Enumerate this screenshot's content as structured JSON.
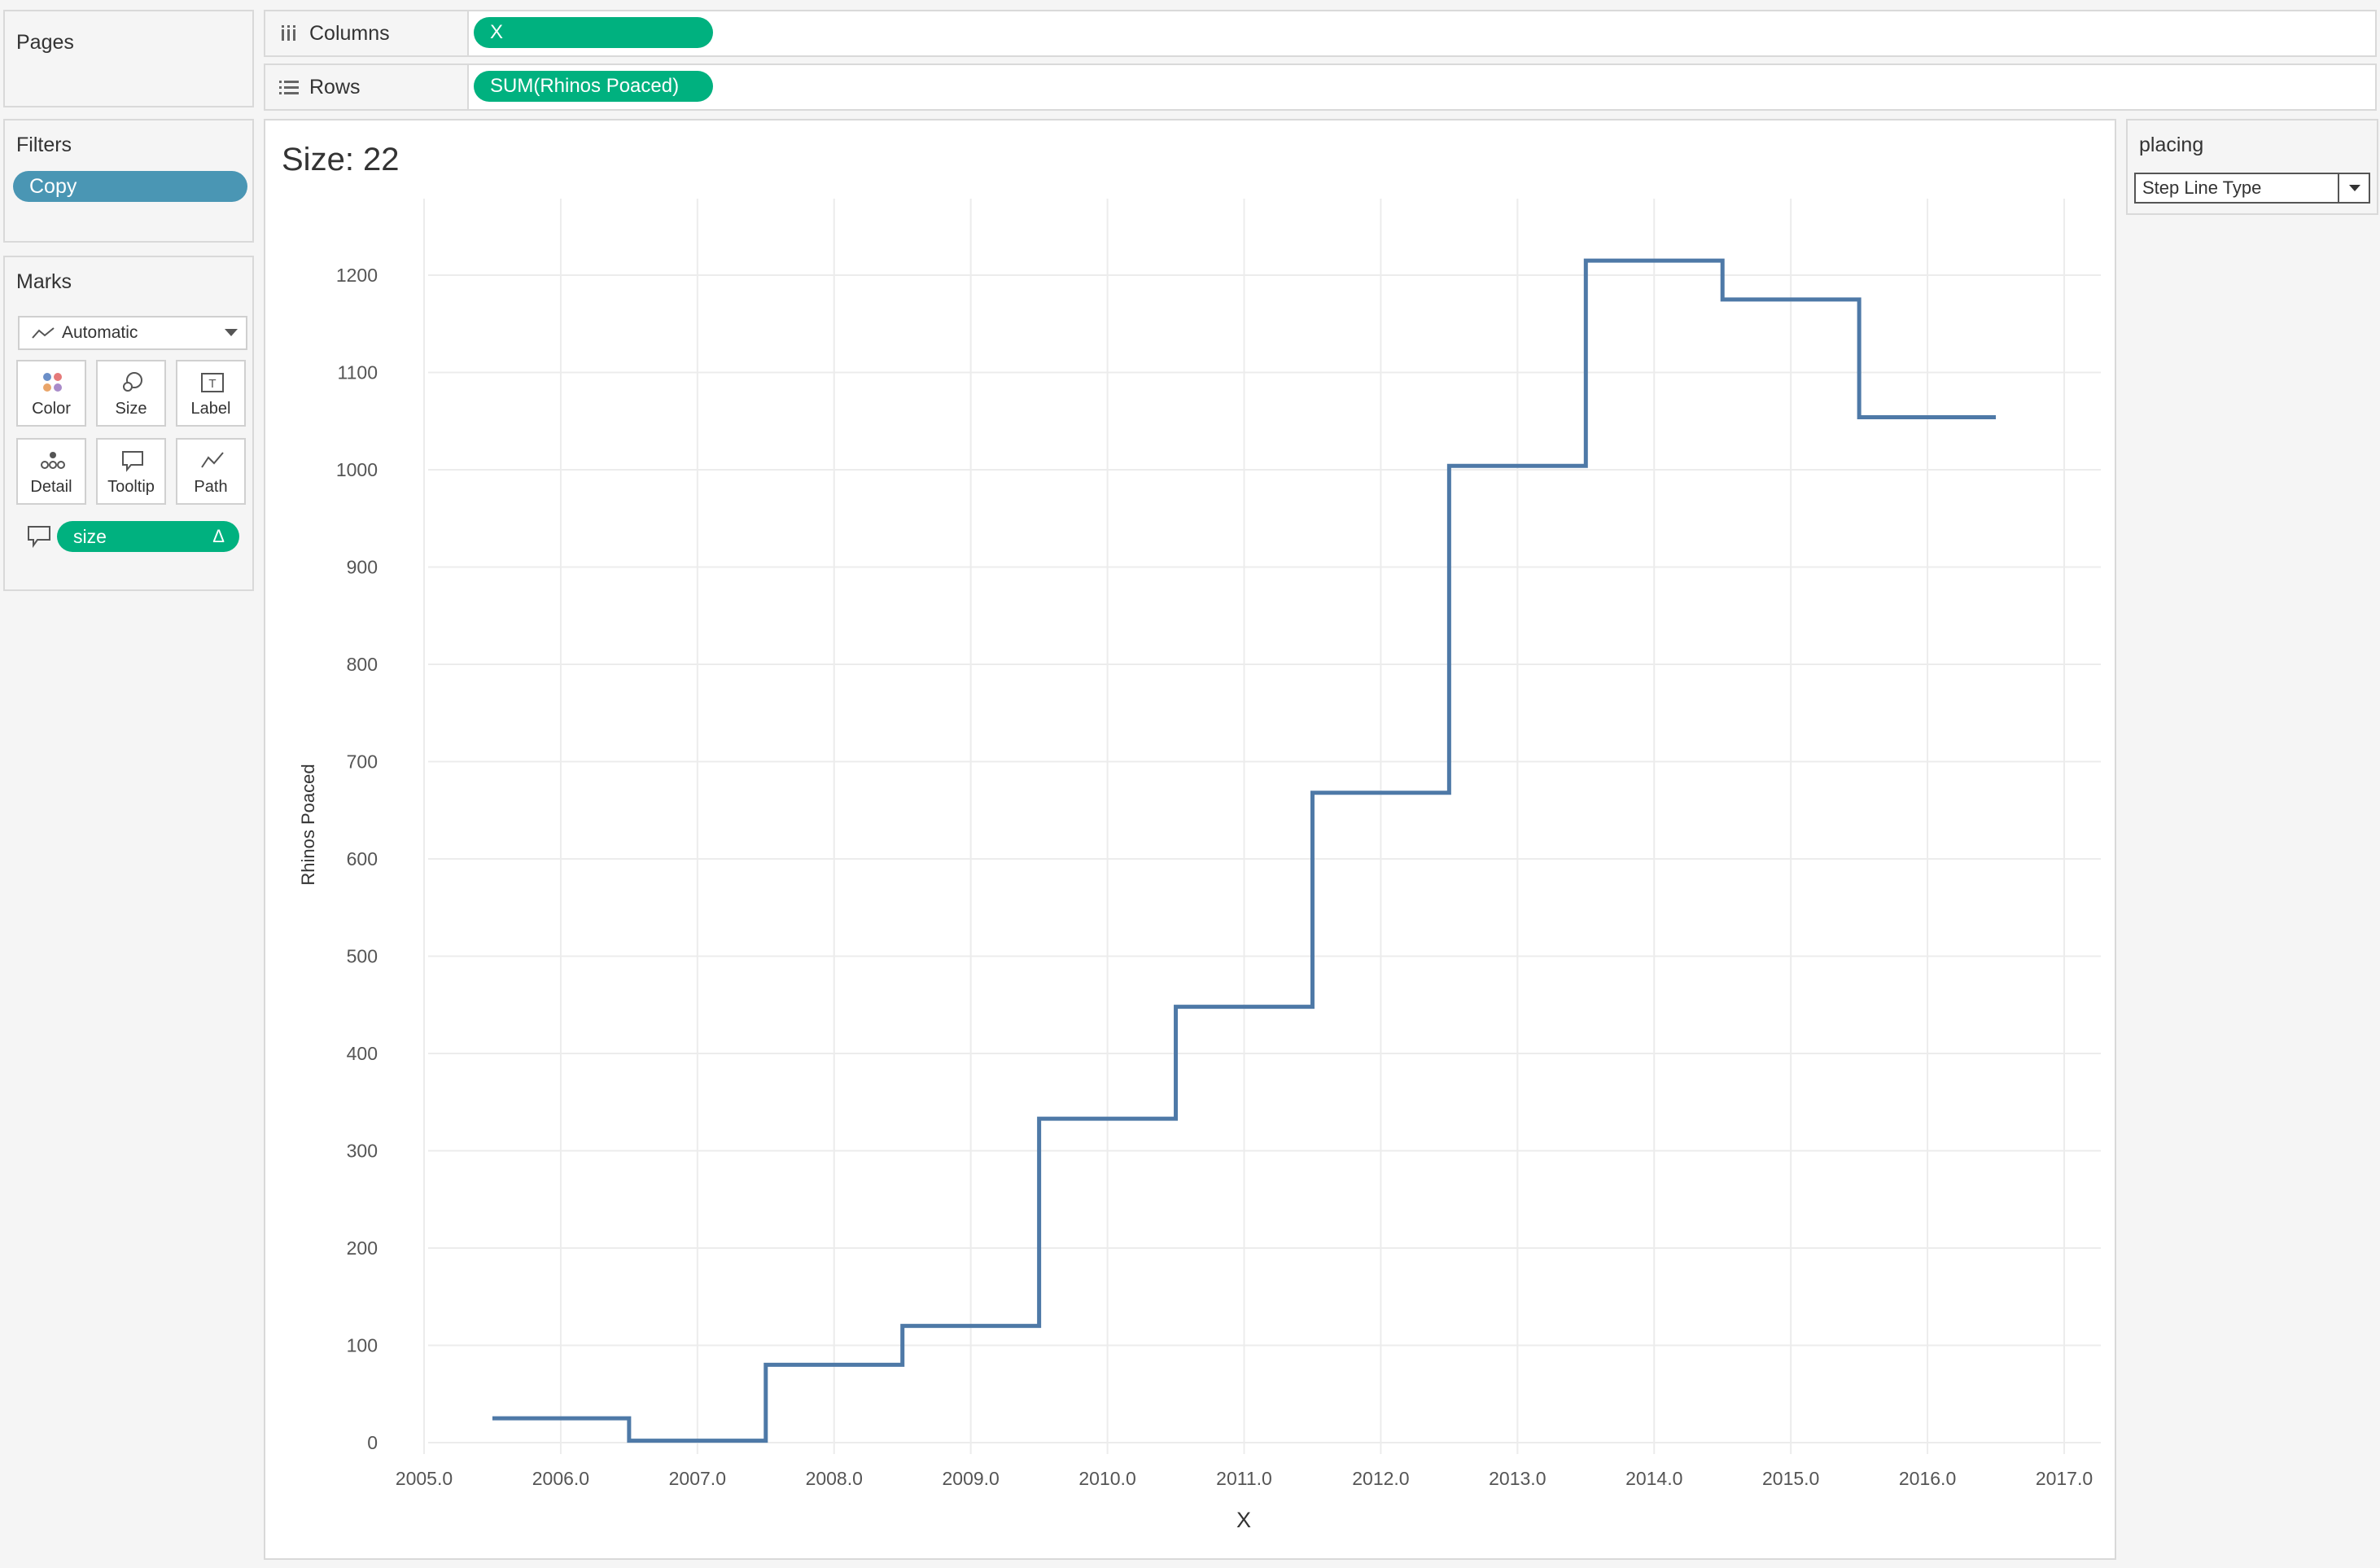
{
  "pages": {
    "title": "Pages"
  },
  "shelves": {
    "columns": {
      "label": "Columns",
      "pill": "X"
    },
    "rows": {
      "label": "Rows",
      "pill": "SUM(Rhinos Poaced)"
    }
  },
  "filters": {
    "title": "Filters",
    "pills": [
      "Copy"
    ]
  },
  "marks": {
    "title": "Marks",
    "mark_type": "Automatic",
    "buttons": {
      "color": "Color",
      "size": "Size",
      "label": "Label",
      "detail": "Detail",
      "tooltip": "Tooltip",
      "path": "Path"
    },
    "field_pill": "size",
    "field_pill_symbol": "Δ"
  },
  "parameter": {
    "title": "placing",
    "value": "Step Line Type"
  },
  "viz": {
    "title": "Size: 22"
  },
  "colors": {
    "line": "#4e79a7",
    "pill_green": "#00b17f",
    "pill_blue": "#4a96b4",
    "grid": "#ececec"
  },
  "chart_data": {
    "type": "line",
    "line_style": "step",
    "title": "",
    "xlabel": "X",
    "ylabel": "Rhinos Poaced",
    "x": [
      2006,
      2007,
      2008,
      2009,
      2010,
      2011,
      2012,
      2013,
      2014,
      2015,
      2016
    ],
    "series": [
      {
        "values": [
          25,
          2,
          80,
          120,
          333,
          448,
          668,
          1004,
          1215,
          1175,
          1054
        ]
      }
    ],
    "xlim": [
      2005,
      2017
    ],
    "ylim": [
      0,
      1200
    ],
    "x_ticks": [
      "2005.0",
      "2006.0",
      "2007.0",
      "2008.0",
      "2009.0",
      "2010.0",
      "2011.0",
      "2012.0",
      "2013.0",
      "2014.0",
      "2015.0",
      "2016.0",
      "2017.0"
    ],
    "y_ticks": [
      "0",
      "100",
      "200",
      "300",
      "400",
      "500",
      "600",
      "700",
      "800",
      "900",
      "1000",
      "1100",
      "1200"
    ],
    "grid": true,
    "legend": "none"
  }
}
